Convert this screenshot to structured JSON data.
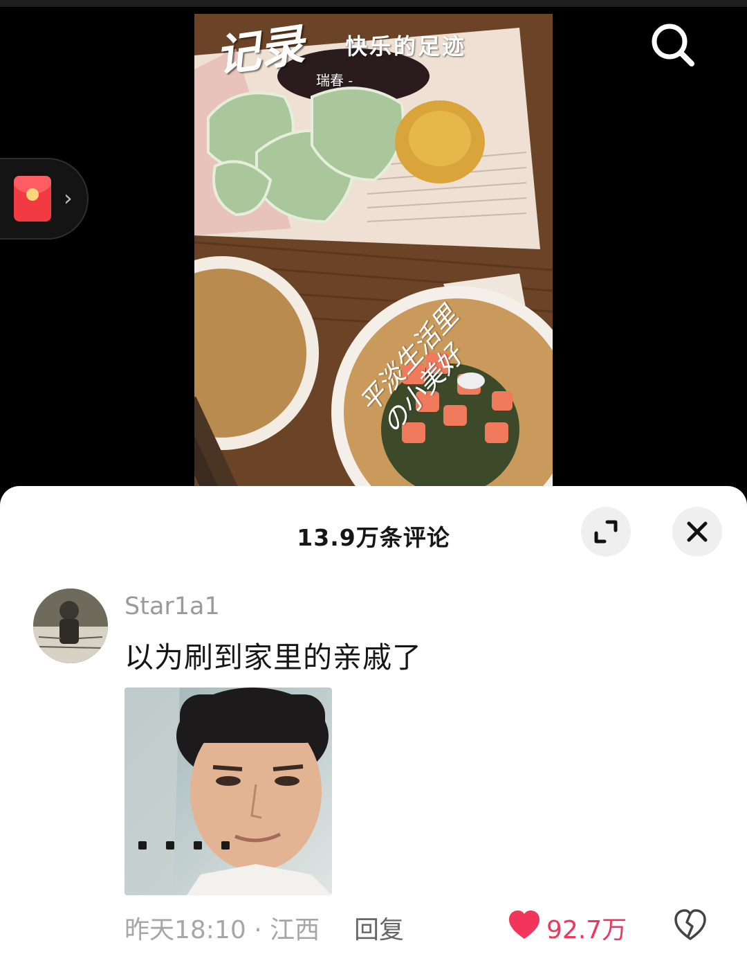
{
  "video": {
    "overlay_title": "记录",
    "overlay_subtitle": "快乐的足迹",
    "overlay_small": "瑞春 -",
    "overlay_diagonal_line1": "平淡生活里",
    "overlay_diagonal_line2": "の小美好"
  },
  "icons": {
    "search": "search-icon",
    "red_packet": "red-packet-icon",
    "chevron": "chevron-right-icon",
    "expand": "expand-icon",
    "close": "close-icon",
    "like": "heart-icon",
    "dislike": "broken-heart-icon"
  },
  "colors": {
    "accent_like": "#f2355a",
    "red_packet": "#f23a43",
    "sheet_bg": "#ffffff"
  },
  "comments_panel": {
    "title": "13.9万条评论"
  },
  "comment": {
    "username": "Star1a1",
    "text": "以为刷到家里的亲戚了",
    "time_location": "昨天18:10 · 江西",
    "reply_label": "回复",
    "like_count": "92.7万",
    "liked": true
  }
}
